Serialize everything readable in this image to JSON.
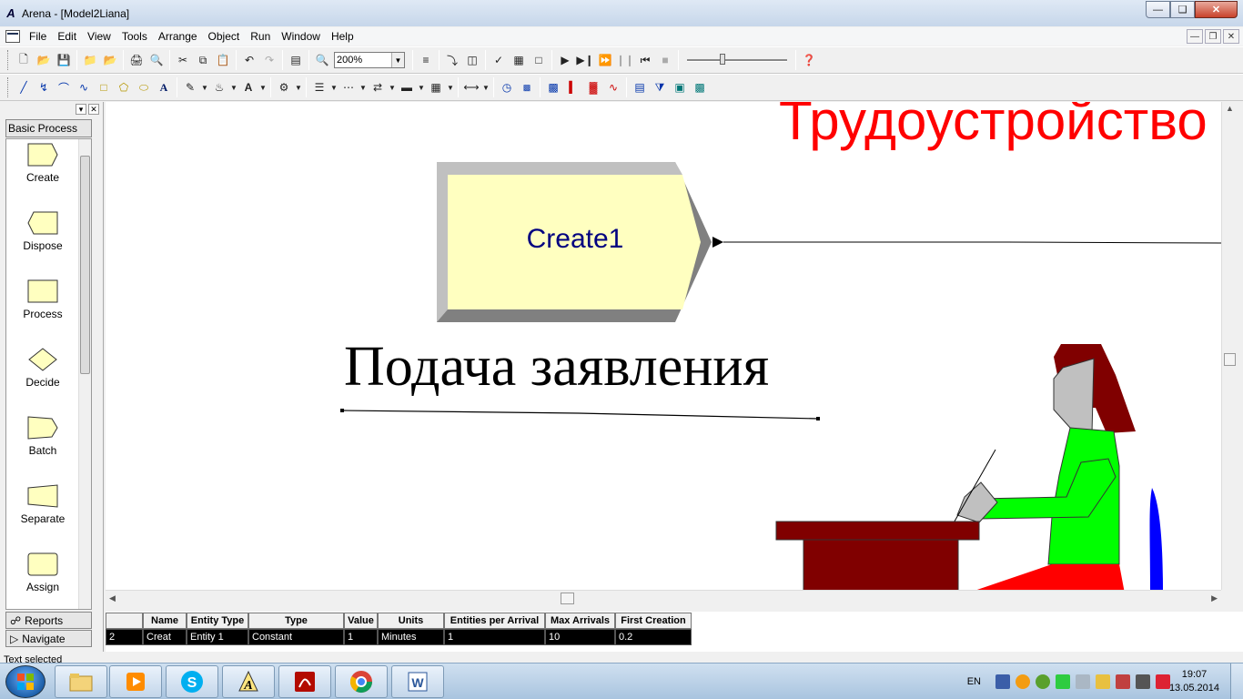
{
  "window": {
    "title": "Arena - [Model2Liana]"
  },
  "menu": [
    "File",
    "Edit",
    "View",
    "Tools",
    "Arrange",
    "Object",
    "Run",
    "Window",
    "Help"
  ],
  "toolbar": {
    "zoom": "200%"
  },
  "project_bar": {
    "panel": "Basic Process",
    "modules": [
      "Create",
      "Dispose",
      "Process",
      "Decide",
      "Batch",
      "Separate",
      "Assign"
    ],
    "tabs": [
      "Reports",
      "Navigate"
    ]
  },
  "canvas": {
    "heading": "Трудоустройство",
    "create_module_label": "Create1",
    "big_label": "Подача заявления",
    "colors": {
      "heading": "#ff0000",
      "module_fill": "#ffffc0",
      "module_text": "#000080"
    }
  },
  "sheet": {
    "headers": [
      "Name",
      "Entity Type",
      "Type",
      "Value",
      "Units",
      "Entities per Arrival",
      "Max Arrivals",
      "First Creation"
    ],
    "rows": [
      {
        "index": "2",
        "cells": [
          "Creat",
          "Entity 1",
          "Constant",
          "1",
          "Minutes",
          "1",
          "10",
          "0.2"
        ]
      }
    ]
  },
  "status": {
    "text": "Text selected"
  },
  "taskbar": {
    "apps": [
      "windows-explorer",
      "media-player",
      "skype",
      "arena",
      "adobe-reader",
      "chrome",
      "word"
    ],
    "lang": "EN",
    "time": "19:07",
    "date": "13.05.2014"
  }
}
